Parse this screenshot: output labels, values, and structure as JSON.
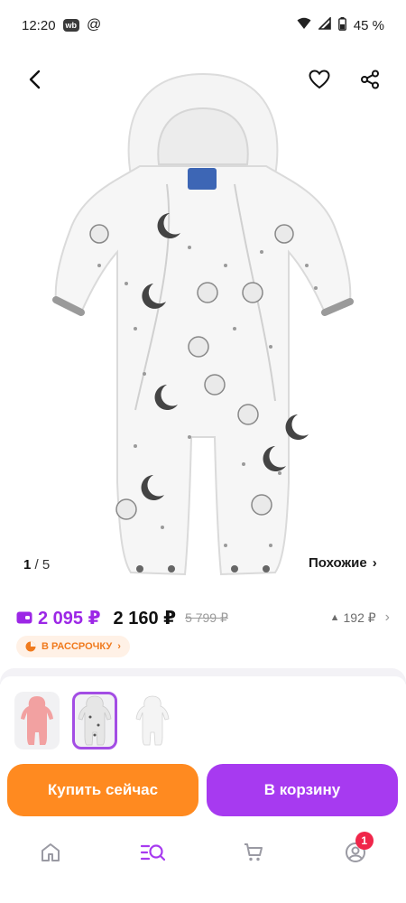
{
  "status_bar": {
    "time": "12:20",
    "wb_label": "wb",
    "at_symbol": "@",
    "battery": "45 %"
  },
  "gallery": {
    "current": "1",
    "separator": "/",
    "total": "5",
    "similar_label": "Похожие",
    "similar_chevron": "›"
  },
  "pricing": {
    "wallet_price": "2 095 ₽",
    "price": "2 160 ₽",
    "old_price": "5 799 ₽",
    "history_arrow": "▲",
    "history_price": "192 ₽",
    "history_chevron": "›",
    "installment_label": "В РАССРОЧКУ",
    "installment_chevron": "›",
    "wallet_color": "#9c27e6",
    "installment_color": "#f07a1d"
  },
  "variants": [
    {
      "name": "pink",
      "color": "#f2a1a1",
      "selected": false
    },
    {
      "name": "white-moon",
      "color": "#e6e6e6",
      "selected": true
    },
    {
      "name": "white",
      "color": "#f4f4f4",
      "selected": false
    }
  ],
  "actions": {
    "buy_now_label": "Купить сейчас",
    "add_to_cart_label": "В корзину",
    "buy_color": "#ff8a20",
    "cart_color": "#a73af0"
  },
  "bottom_nav": {
    "items": [
      {
        "name": "home",
        "icon": "home-icon"
      },
      {
        "name": "catalog",
        "icon": "catalog-search-icon",
        "active": true
      },
      {
        "name": "cart",
        "icon": "cart-icon"
      },
      {
        "name": "profile",
        "icon": "profile-icon",
        "badge": "1"
      }
    ],
    "active_color": "#a73af0"
  }
}
